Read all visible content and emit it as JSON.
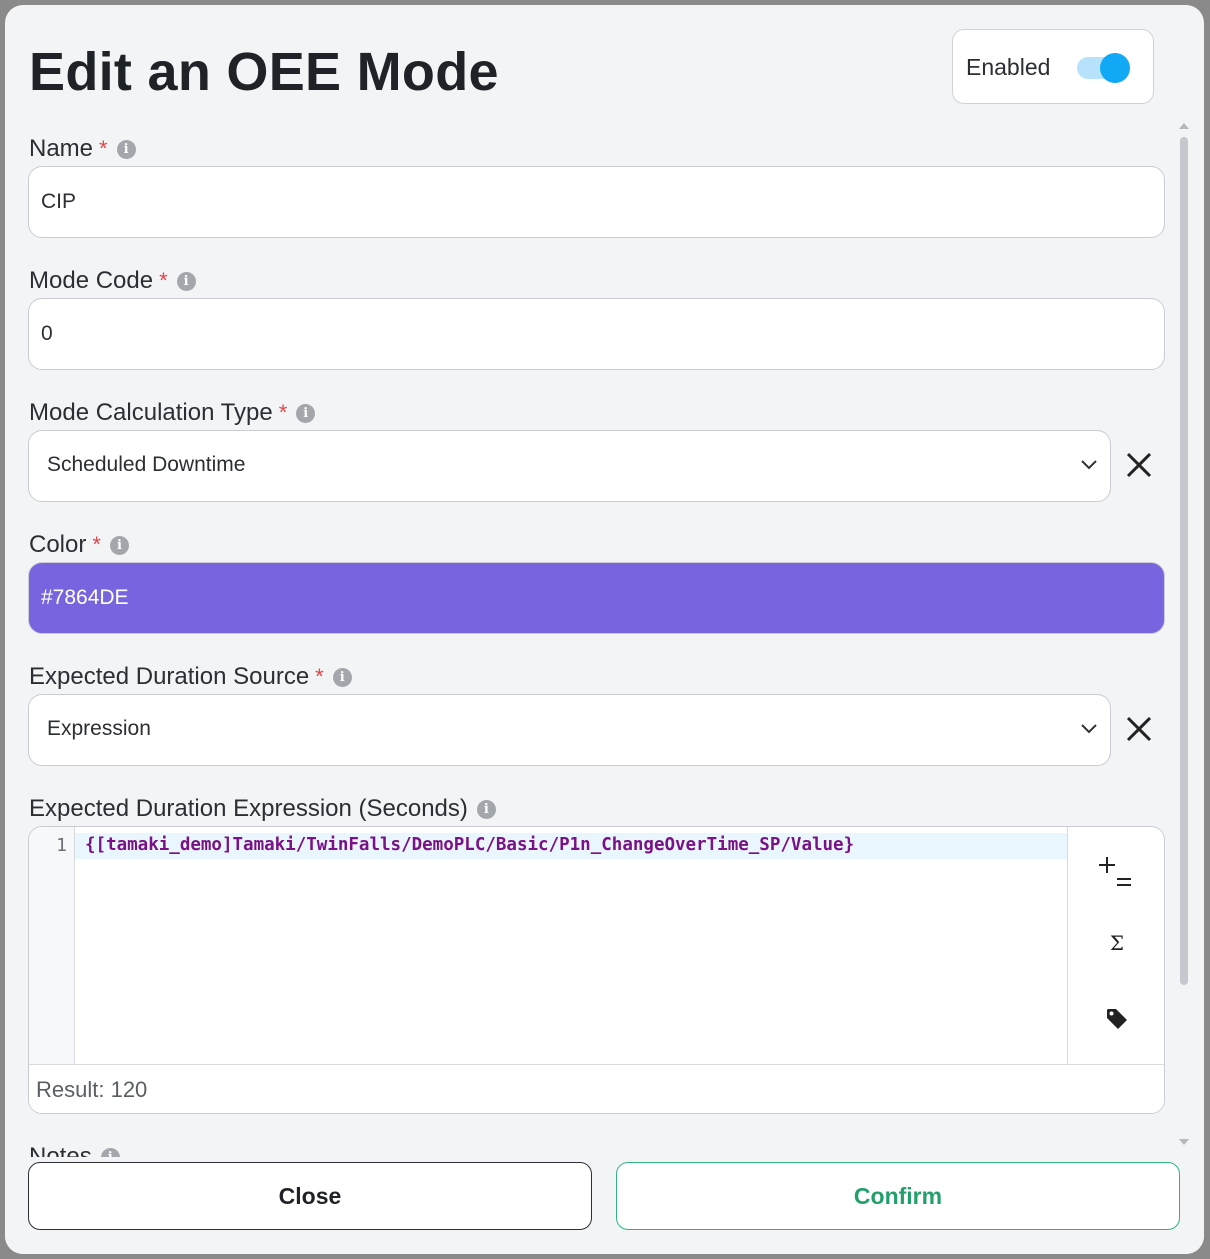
{
  "dialog": {
    "title": "Edit an OEE Mode",
    "enabled_label": "Enabled",
    "enabled": true
  },
  "required_marker": "*",
  "fields": {
    "name": {
      "label": "Name",
      "value": "CIP"
    },
    "mode_code": {
      "label": "Mode Code",
      "value": "0"
    },
    "mode_calculation_type": {
      "label": "Mode Calculation Type",
      "value": "Scheduled Downtime"
    },
    "color": {
      "label": "Color",
      "value": "#7864DE"
    },
    "expected_duration_source": {
      "label": "Expected Duration Source",
      "value": "Expression"
    },
    "expected_duration_expression": {
      "label": "Expected Duration Expression (Seconds)",
      "line_number": "1",
      "code": "{[tamaki_demo]Tamaki/TwinFalls/DemoPLC/Basic/P1n_ChangeOverTime_SP/Value}",
      "result": "Result: 120"
    },
    "notes": {
      "label": "Notes"
    }
  },
  "editor_tools": [
    {
      "icon": "operators-icon"
    },
    {
      "icon": "sigma-function-icon",
      "glyph": "Σ"
    },
    {
      "icon": "tag-icon"
    }
  ],
  "buttons": {
    "close": "Close",
    "confirm": "Confirm"
  },
  "colors": {
    "accent_toggle": "#11a9f6",
    "confirm_green": "#22a06b",
    "required_red": "#e0464b",
    "code_purple": "#7a1186"
  }
}
